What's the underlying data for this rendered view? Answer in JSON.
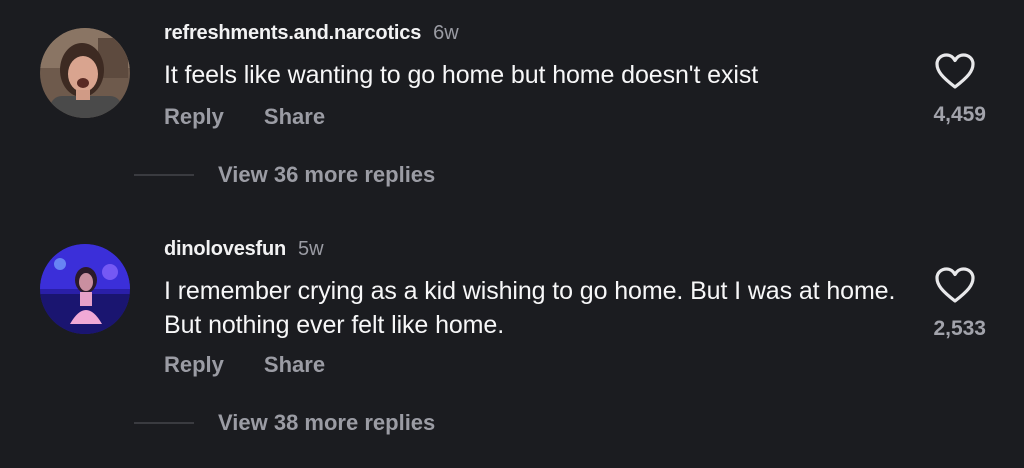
{
  "comments": [
    {
      "username": "refreshments.and.narcotics",
      "age": "6w",
      "text": "It feels like wanting to go home but home doesn't exist",
      "reply_label": "Reply",
      "share_label": "Share",
      "like_count": "4,459",
      "like_icon": "heart-outline-icon",
      "view_replies_label": "View 36 more replies"
    },
    {
      "username": "dinolovesfun",
      "age": "5w",
      "text": "I remember crying as a kid wishing to go home. But I was at home. But nothing ever felt like home.",
      "reply_label": "Reply",
      "share_label": "Share",
      "like_count": "2,533",
      "like_icon": "heart-outline-icon",
      "view_replies_label": "View 38 more replies"
    }
  ],
  "colors": {
    "background": "#1b1c20",
    "primary_text": "#f7f7f8",
    "secondary_text": "#9b9ca4",
    "divider": "#3a3b40"
  }
}
